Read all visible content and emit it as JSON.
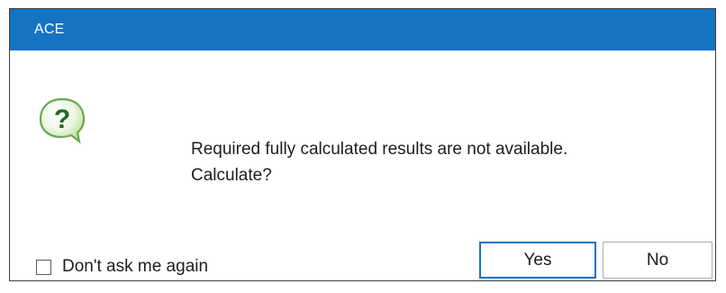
{
  "window": {
    "title": "ACE",
    "accent_color": "#1573c4"
  },
  "icon": {
    "name": "question-icon",
    "glyph": "?"
  },
  "message": {
    "line1": "Required fully calculated results are not available.",
    "line2": "Calculate?"
  },
  "checkbox": {
    "label": "Don't ask me again",
    "checked": false
  },
  "buttons": {
    "yes_label": "Yes",
    "no_label": "No"
  }
}
